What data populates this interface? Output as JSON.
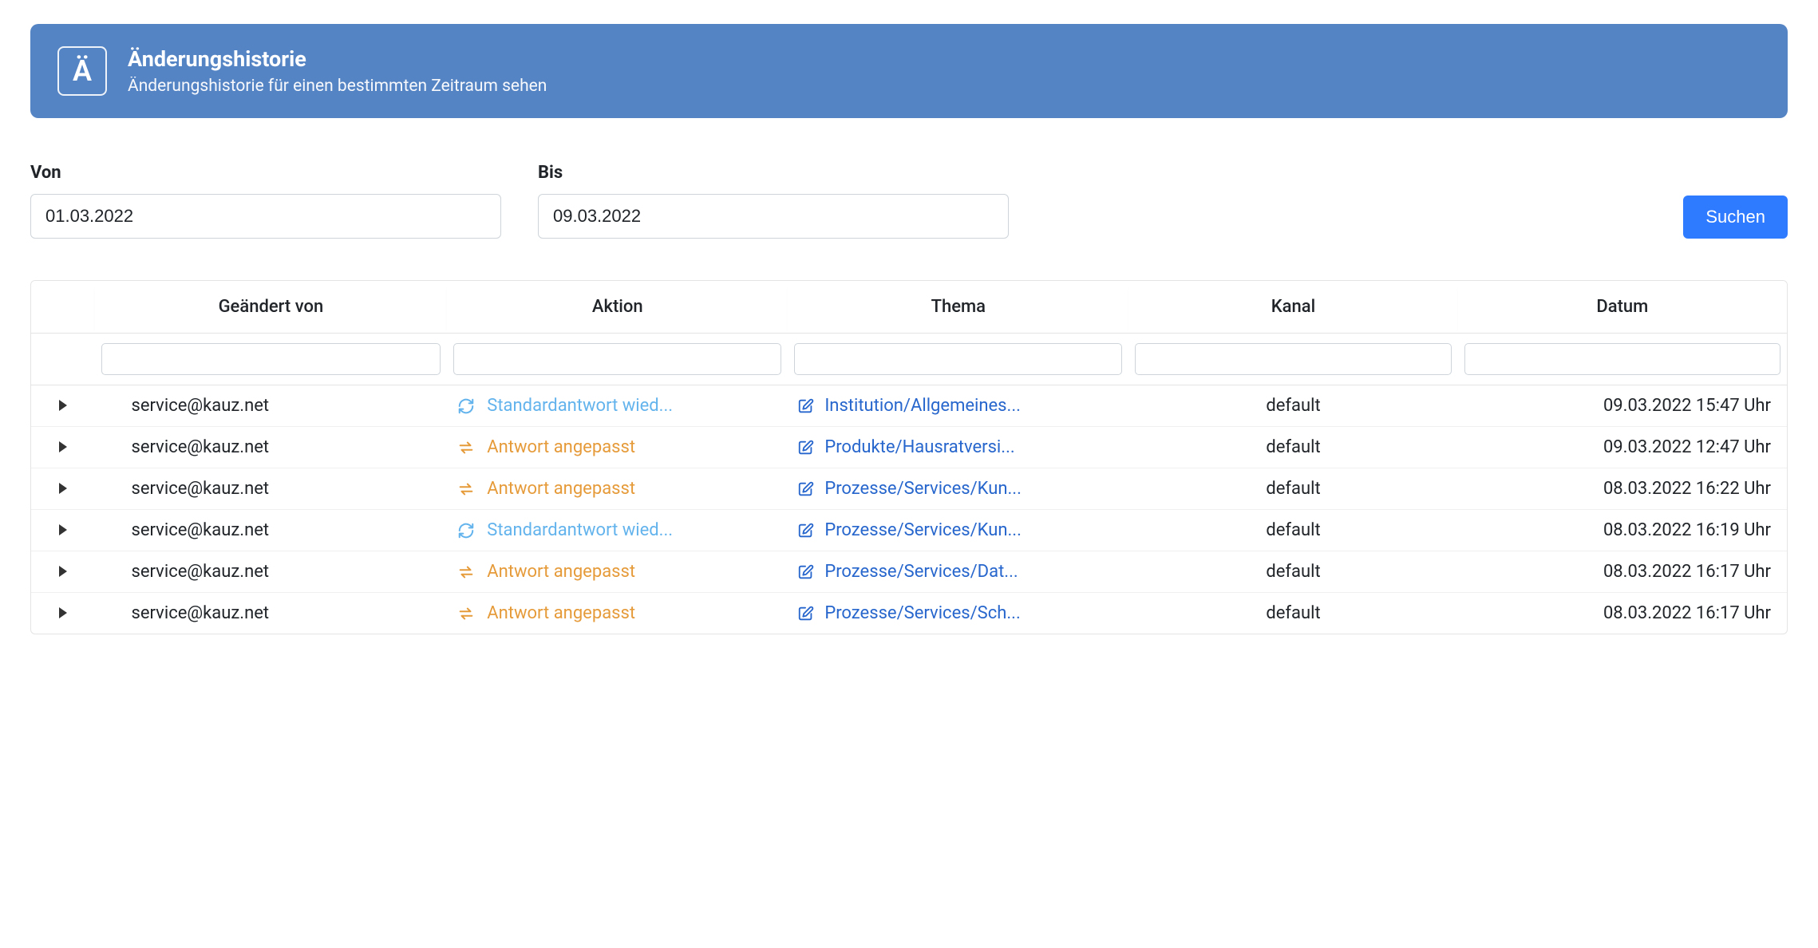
{
  "header": {
    "icon_letter": "Ä",
    "title": "Änderungshistorie",
    "subtitle": "Änderungshistorie für einen bestimmten Zeitraum sehen"
  },
  "filters": {
    "from_label": "Von",
    "from_value": "01.03.2022",
    "to_label": "Bis",
    "to_value": "09.03.2022",
    "search_label": "Suchen"
  },
  "table": {
    "columns": {
      "user": "Geändert von",
      "action": "Aktion",
      "topic": "Thema",
      "channel": "Kanal",
      "date": "Datum"
    },
    "rows": [
      {
        "user": "service@kauz.net",
        "action_type": "restore",
        "action_text": "Standardantwort wied...",
        "topic": "Institution/Allgemeines...",
        "channel": "default",
        "date": "09.03.2022 15:47 Uhr"
      },
      {
        "user": "service@kauz.net",
        "action_type": "adjust",
        "action_text": "Antwort angepasst",
        "topic": "Produkte/Hausratversi...",
        "channel": "default",
        "date": "09.03.2022 12:47 Uhr"
      },
      {
        "user": "service@kauz.net",
        "action_type": "adjust",
        "action_text": "Antwort angepasst",
        "topic": "Prozesse/Services/Kun...",
        "channel": "default",
        "date": "08.03.2022 16:22 Uhr"
      },
      {
        "user": "service@kauz.net",
        "action_type": "restore",
        "action_text": "Standardantwort wied...",
        "topic": "Prozesse/Services/Kun...",
        "channel": "default",
        "date": "08.03.2022 16:19 Uhr"
      },
      {
        "user": "service@kauz.net",
        "action_type": "adjust",
        "action_text": "Antwort angepasst",
        "topic": "Prozesse/Services/Dat...",
        "channel": "default",
        "date": "08.03.2022 16:17 Uhr"
      },
      {
        "user": "service@kauz.net",
        "action_type": "adjust",
        "action_text": "Antwort angepasst",
        "topic": "Prozesse/Services/Sch...",
        "channel": "default",
        "date": "08.03.2022 16:17 Uhr"
      }
    ]
  }
}
